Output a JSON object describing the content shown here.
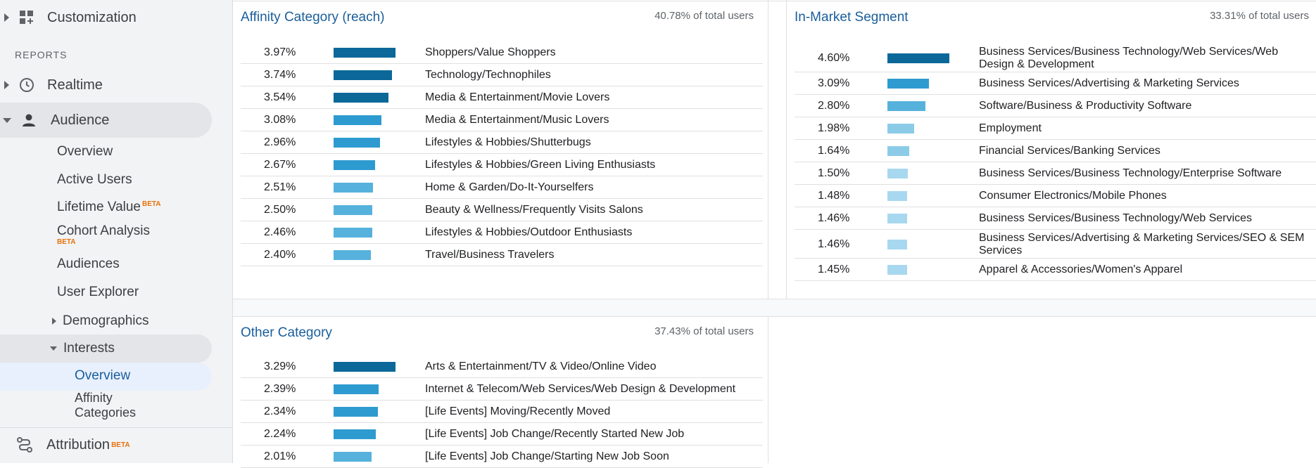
{
  "sidebar": {
    "customization": {
      "label": "Customization",
      "icon": "dashboard-plus-icon"
    },
    "reports_label": "REPORTS",
    "realtime": {
      "label": "Realtime",
      "icon": "clock-icon"
    },
    "audience": {
      "label": "Audience",
      "icon": "person-icon"
    },
    "audience_items": {
      "overview": "Overview",
      "active_users": "Active Users",
      "lifetime_value": "Lifetime Value",
      "cohort_analysis": "Cohort Analysis",
      "audiences": "Audiences",
      "user_explorer": "User Explorer",
      "demographics": "Demographics",
      "interests": "Interests",
      "interests_overview": "Overview",
      "affinity_categories_line1": "Affinity",
      "affinity_categories_line2": "Categories"
    },
    "beta": "BETA",
    "attribution": {
      "label": "Attribution",
      "icon": "attribution-icon"
    }
  },
  "colors": {
    "accent_title": "#1a5e9a",
    "bar_dark": "#0b6899",
    "bar_mid": "#2e9bd0",
    "bar_light": "#56b2dc",
    "bar_lighter": "#8ccbe8",
    "bar_lightest": "#a8d8ef"
  },
  "affinity": {
    "title": "Affinity Category (reach)",
    "total": "40.78% of total users",
    "rows": [
      {
        "pct": "3.97%",
        "value": 3.97,
        "label": "Shoppers/Value Shoppers",
        "tone": "dark"
      },
      {
        "pct": "3.74%",
        "value": 3.74,
        "label": "Technology/Technophiles",
        "tone": "dark"
      },
      {
        "pct": "3.54%",
        "value": 3.54,
        "label": "Media & Entertainment/Movie Lovers",
        "tone": "dark"
      },
      {
        "pct": "3.08%",
        "value": 3.08,
        "label": "Media & Entertainment/Music Lovers",
        "tone": "mid"
      },
      {
        "pct": "2.96%",
        "value": 2.96,
        "label": "Lifestyles & Hobbies/Shutterbugs",
        "tone": "mid"
      },
      {
        "pct": "2.67%",
        "value": 2.67,
        "label": "Lifestyles & Hobbies/Green Living Enthusiasts",
        "tone": "mid"
      },
      {
        "pct": "2.51%",
        "value": 2.51,
        "label": "Home & Garden/Do-It-Yourselfers",
        "tone": "light"
      },
      {
        "pct": "2.50%",
        "value": 2.5,
        "label": "Beauty & Wellness/Frequently Visits Salons",
        "tone": "light"
      },
      {
        "pct": "2.46%",
        "value": 2.46,
        "label": "Lifestyles & Hobbies/Outdoor Enthusiasts",
        "tone": "light"
      },
      {
        "pct": "2.40%",
        "value": 2.4,
        "label": "Travel/Business Travelers",
        "tone": "light"
      }
    ]
  },
  "in_market": {
    "title": "In-Market Segment",
    "total": "33.31% of total users",
    "rows": [
      {
        "pct": "4.60%",
        "value": 4.6,
        "label": "Business Services/Business Technology/Web Services/Web Design & Development",
        "tone": "dark"
      },
      {
        "pct": "3.09%",
        "value": 3.09,
        "label": "Business Services/Advertising & Marketing Services",
        "tone": "mid"
      },
      {
        "pct": "2.80%",
        "value": 2.8,
        "label": "Software/Business & Productivity Software",
        "tone": "light"
      },
      {
        "pct": "1.98%",
        "value": 1.98,
        "label": "Employment",
        "tone": "lighter"
      },
      {
        "pct": "1.64%",
        "value": 1.64,
        "label": "Financial Services/Banking Services",
        "tone": "lighter"
      },
      {
        "pct": "1.50%",
        "value": 1.5,
        "label": "Business Services/Business Technology/Enterprise Software",
        "tone": "lightest"
      },
      {
        "pct": "1.48%",
        "value": 1.48,
        "label": "Consumer Electronics/Mobile Phones",
        "tone": "lightest"
      },
      {
        "pct": "1.46%",
        "value": 1.46,
        "label": "Business Services/Business Technology/Web Services",
        "tone": "lightest"
      },
      {
        "pct": "1.46%",
        "value": 1.46,
        "label": "Business Services/Advertising & Marketing Services/SEO & SEM Services",
        "tone": "lightest"
      },
      {
        "pct": "1.45%",
        "value": 1.45,
        "label": "Apparel & Accessories/Women's Apparel",
        "tone": "lightest"
      }
    ]
  },
  "other": {
    "title": "Other Category",
    "total": "37.43% of total users",
    "rows": [
      {
        "pct": "3.29%",
        "value": 3.29,
        "label": "Arts & Entertainment/TV & Video/Online Video",
        "tone": "dark"
      },
      {
        "pct": "2.39%",
        "value": 2.39,
        "label": "Internet & Telecom/Web Services/Web Design & Development",
        "tone": "mid"
      },
      {
        "pct": "2.34%",
        "value": 2.34,
        "label": "[Life Events] Moving/Recently Moved",
        "tone": "mid"
      },
      {
        "pct": "2.24%",
        "value": 2.24,
        "label": "[Life Events] Job Change/Recently Started New Job",
        "tone": "mid"
      },
      {
        "pct": "2.01%",
        "value": 2.01,
        "label": "[Life Events] Job Change/Starting New Job Soon",
        "tone": "light"
      }
    ]
  }
}
